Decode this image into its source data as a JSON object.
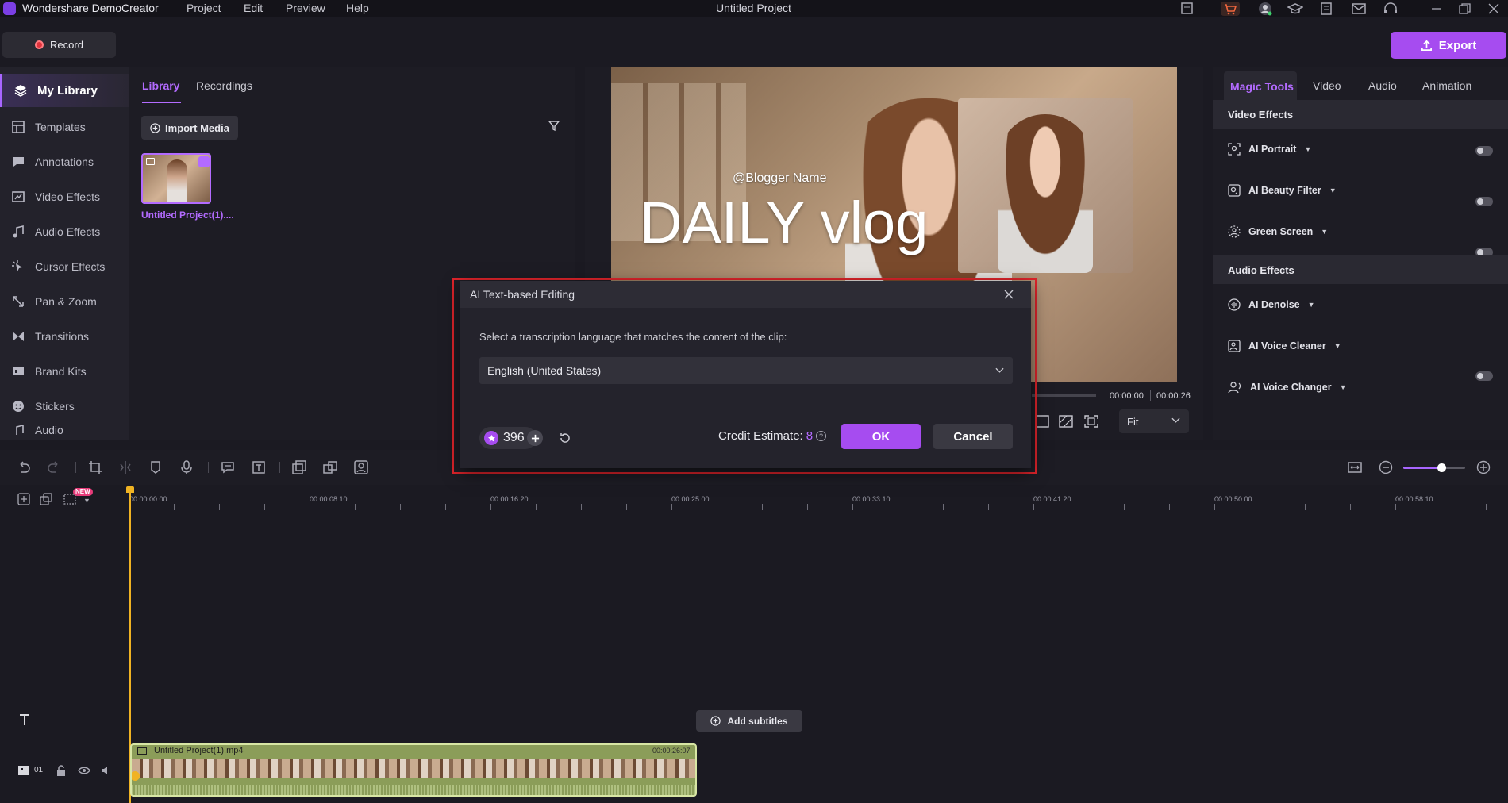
{
  "app": {
    "name": "Wondershare DemoCreator",
    "menu": [
      "Project",
      "Edit",
      "Preview",
      "Help"
    ],
    "project_title": "Untitled Project"
  },
  "topbar": {
    "record_label": "Record",
    "export_label": "Export"
  },
  "sidebar": {
    "items": [
      {
        "label": "My Library",
        "icon": "library-icon"
      },
      {
        "label": "Templates",
        "icon": "templates-icon"
      },
      {
        "label": "Annotations",
        "icon": "annotations-icon"
      },
      {
        "label": "Video Effects",
        "icon": "video-effects-icon"
      },
      {
        "label": "Audio Effects",
        "icon": "audio-effects-icon"
      },
      {
        "label": "Cursor Effects",
        "icon": "cursor-effects-icon"
      },
      {
        "label": "Pan & Zoom",
        "icon": "pan-zoom-icon"
      },
      {
        "label": "Transitions",
        "icon": "transitions-icon"
      },
      {
        "label": "Brand Kits",
        "icon": "brand-kits-icon"
      },
      {
        "label": "Stickers",
        "icon": "stickers-icon"
      },
      {
        "label": "Audio",
        "icon": "audio-icon"
      }
    ]
  },
  "library": {
    "tabs": [
      "Library",
      "Recordings"
    ],
    "import_label": "Import Media",
    "media_item_name": "Untitled Project(1)...."
  },
  "preview": {
    "overlay_name": "@Blogger Name",
    "overlay_title": "DAILY vlog",
    "time_current": "00:00:00",
    "time_total": "00:00:26",
    "zoom_option": "Fit"
  },
  "right_panel": {
    "tabs": [
      "Magic Tools",
      "Video",
      "Audio",
      "Animation"
    ],
    "video_effects_title": "Video Effects",
    "video_effects": [
      "AI Portrait",
      "AI Beauty Filter",
      "Green Screen"
    ],
    "audio_effects_title": "Audio Effects",
    "audio_effects": [
      "AI Denoise",
      "AI Voice Cleaner",
      "AI Voice Changer"
    ]
  },
  "timeline": {
    "ruler_labels": [
      "00:00:00:00",
      "00:00:08:10",
      "00:00:16:20",
      "00:00:25:00",
      "00:00:33:10",
      "00:00:41:20",
      "00:00:50:00",
      "00:00:58:10"
    ],
    "new_badge": "NEW",
    "add_subtitles_label": "Add subtitles",
    "track_number": "01",
    "clip_name": "Untitled Project(1).mp4",
    "clip_duration": "00:00:26:07"
  },
  "dialog": {
    "title": "AI Text-based Editing",
    "prompt": "Select a transcription language that matches the content of the clip:",
    "language": "English (United States)",
    "credits": "396",
    "credit_estimate_label": "Credit Estimate:",
    "credit_estimate_value": "8",
    "ok_label": "OK",
    "cancel_label": "Cancel"
  },
  "colors": {
    "accent": "#a64cf0",
    "highlight_frame": "#e0242b",
    "playhead": "#f0b323",
    "clip": "#8b9d59"
  }
}
